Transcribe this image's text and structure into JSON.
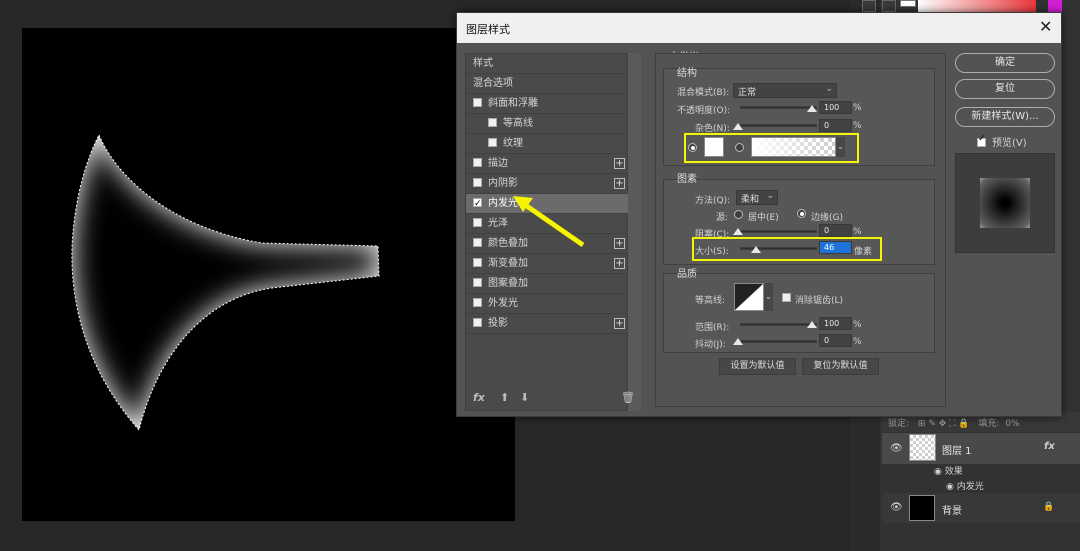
{
  "dialog": {
    "title": "图层样式",
    "style_list": {
      "header": "样式",
      "items": [
        {
          "label": "混合选项",
          "checkbox": false,
          "sub": false,
          "plus": false
        },
        {
          "label": "斜面和浮雕",
          "checkbox": true,
          "checked": false,
          "sub": false,
          "plus": false
        },
        {
          "label": "等高线",
          "checkbox": true,
          "checked": false,
          "sub": true,
          "plus": false
        },
        {
          "label": "纹理",
          "checkbox": true,
          "checked": false,
          "sub": true,
          "plus": false
        },
        {
          "label": "描边",
          "checkbox": true,
          "checked": false,
          "sub": false,
          "plus": true
        },
        {
          "label": "内阴影",
          "checkbox": true,
          "checked": false,
          "sub": false,
          "plus": true
        },
        {
          "label": "内发光",
          "checkbox": true,
          "checked": true,
          "sub": false,
          "plus": false,
          "active": true
        },
        {
          "label": "光泽",
          "checkbox": true,
          "checked": false,
          "sub": false,
          "plus": false
        },
        {
          "label": "颜色叠加",
          "checkbox": true,
          "checked": false,
          "sub": false,
          "plus": true
        },
        {
          "label": "渐变叠加",
          "checkbox": true,
          "checked": false,
          "sub": false,
          "plus": true
        },
        {
          "label": "图案叠加",
          "checkbox": true,
          "checked": false,
          "sub": false,
          "plus": false
        },
        {
          "label": "外发光",
          "checkbox": true,
          "checked": false,
          "sub": false,
          "plus": false
        },
        {
          "label": "投影",
          "checkbox": true,
          "checked": false,
          "sub": false,
          "plus": true
        }
      ],
      "footer_fx": "fx"
    },
    "inner_glow": {
      "title": "内发光",
      "structure": {
        "title": "结构",
        "blend_mode_label": "混合模式(B):",
        "blend_mode_value": "正常",
        "opacity_label": "不透明度(O):",
        "opacity_value": "100",
        "opacity_unit": "%",
        "noise_label": "杂色(N):",
        "noise_value": "0",
        "noise_unit": "%"
      },
      "elements": {
        "title": "图素",
        "technique_label": "方法(Q):",
        "technique_value": "柔和",
        "source_label": "源:",
        "source_center": "居中(E)",
        "source_edge": "边缘(G)",
        "choke_label": "阻塞(C):",
        "choke_value": "0",
        "choke_unit": "%",
        "size_label": "大小(S):",
        "size_value": "46",
        "size_unit": "像素"
      },
      "quality": {
        "title": "品质",
        "contour_label": "等高线:",
        "antialias_label": "消除锯齿(L)",
        "range_label": "范围(R):",
        "range_value": "100",
        "range_unit": "%",
        "jitter_label": "抖动(J):",
        "jitter_value": "0",
        "jitter_unit": "%"
      },
      "set_default": "设置为默认值",
      "reset_default": "复位为默认值"
    },
    "buttons": {
      "ok": "确定",
      "reset": "复位",
      "new_style": "新建样式(W)...",
      "preview": "预览(V)"
    }
  },
  "layers": {
    "lock_label": "锁定:",
    "fill_label": "填充:",
    "fill_value": "0%",
    "layer1_name": "图层 1",
    "effects_label": "效果",
    "inner_glow_effect": "内发光",
    "background_name": "背景",
    "fx_label": "fx"
  },
  "colors": {
    "highlight": "#f5f500",
    "selection": "#1e73d8"
  }
}
